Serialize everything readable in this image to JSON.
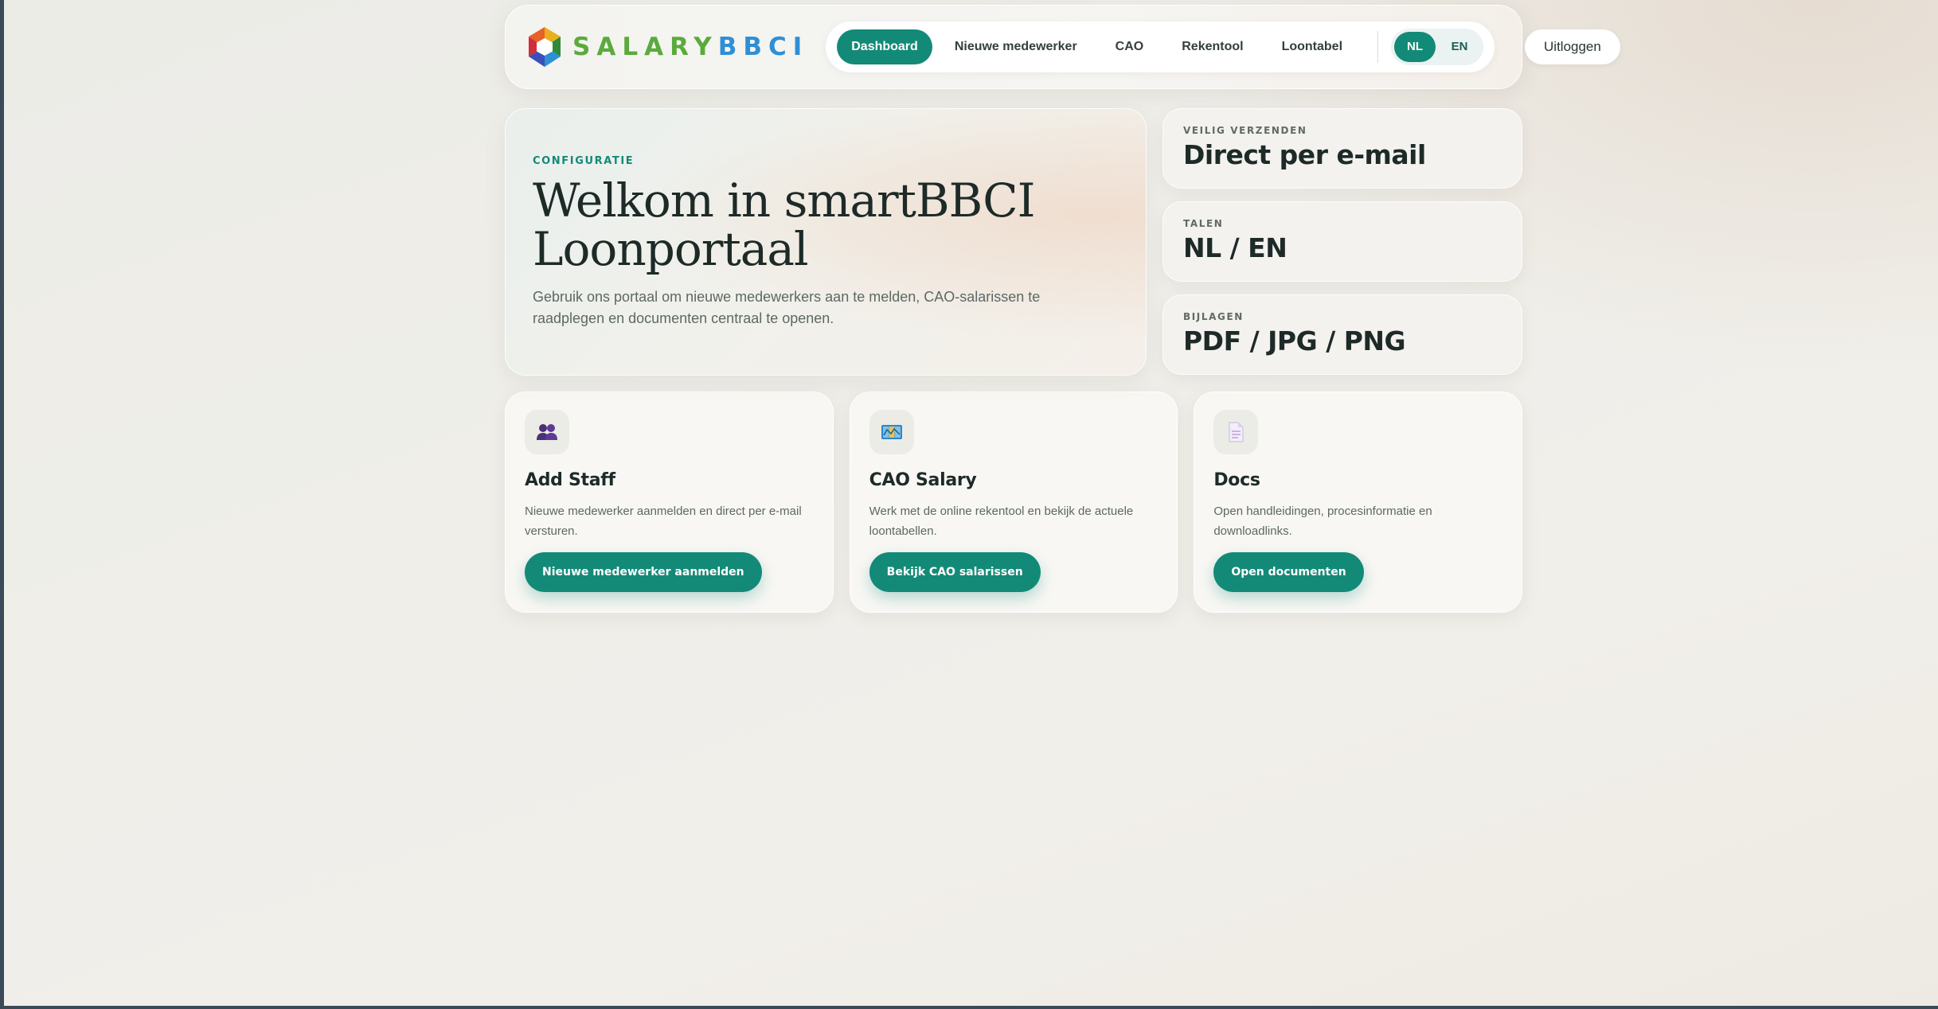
{
  "brand": {
    "part1": "SALARY",
    "part2": "BBCI"
  },
  "nav": {
    "items": [
      {
        "label": "Dashboard",
        "active": true
      },
      {
        "label": "Nieuwe medewerker",
        "active": false
      },
      {
        "label": "CAO",
        "active": false
      },
      {
        "label": "Rekentool",
        "active": false
      },
      {
        "label": "Loontabel",
        "active": false
      }
    ],
    "languages": [
      {
        "label": "NL",
        "active": true
      },
      {
        "label": "EN",
        "active": false
      }
    ],
    "logout_label": "Uitloggen"
  },
  "hero": {
    "eyebrow": "CONFIGURATIE",
    "title_line1": "Welkom in smartBBCI",
    "title_line2": "Loonportaal",
    "text": "Gebruik ons portaal om nieuwe medewerkers aan te melden, CAO-salarissen te raadplegen en documenten centraal te openen."
  },
  "stats": [
    {
      "label": "VEILIG VERZENDEN",
      "value": "Direct per e-mail"
    },
    {
      "label": "TALEN",
      "value": "NL / EN"
    },
    {
      "label": "BIJLAGEN",
      "value": "PDF / JPG / PNG"
    }
  ],
  "cards": [
    {
      "icon": "people-icon",
      "title": "Add Staff",
      "description": "Nieuwe medewerker aanmelden en direct per e-mail versturen.",
      "button": "Nieuwe medewerker aanmelden"
    },
    {
      "icon": "map-icon",
      "title": "CAO Salary",
      "description": "Werk met de online rekentool en bekijk de actuele loontabellen.",
      "button": "Bekijk CAO salarissen"
    },
    {
      "icon": "document-icon",
      "title": "Docs",
      "description": "Open handleidingen, procesinformatie en downloadlinks.",
      "button": "Open documenten"
    }
  ],
  "colors": {
    "accent": "#138a77",
    "brand_green": "#5aaa3c",
    "brand_blue": "#2e8fd6"
  }
}
